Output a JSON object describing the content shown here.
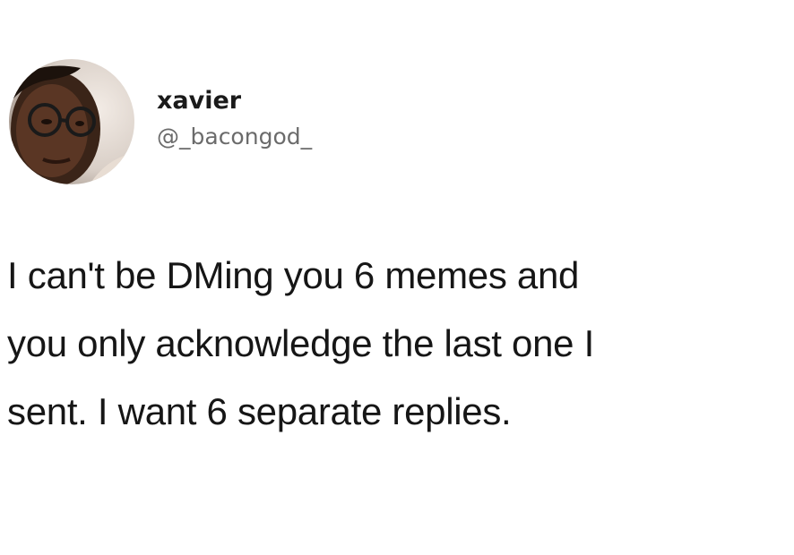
{
  "tweet": {
    "author": {
      "display_name": "xavier",
      "handle": "@_bacongod_",
      "avatar_icon": "profile-photo"
    },
    "text_lines": [
      "I can't be DMing you 6 memes and",
      "you only acknowledge the last one I",
      "sent. I want 6 separate replies."
    ]
  },
  "colors": {
    "background": "#ffffff",
    "text": "#161616",
    "handle": "#6b6b6b"
  }
}
